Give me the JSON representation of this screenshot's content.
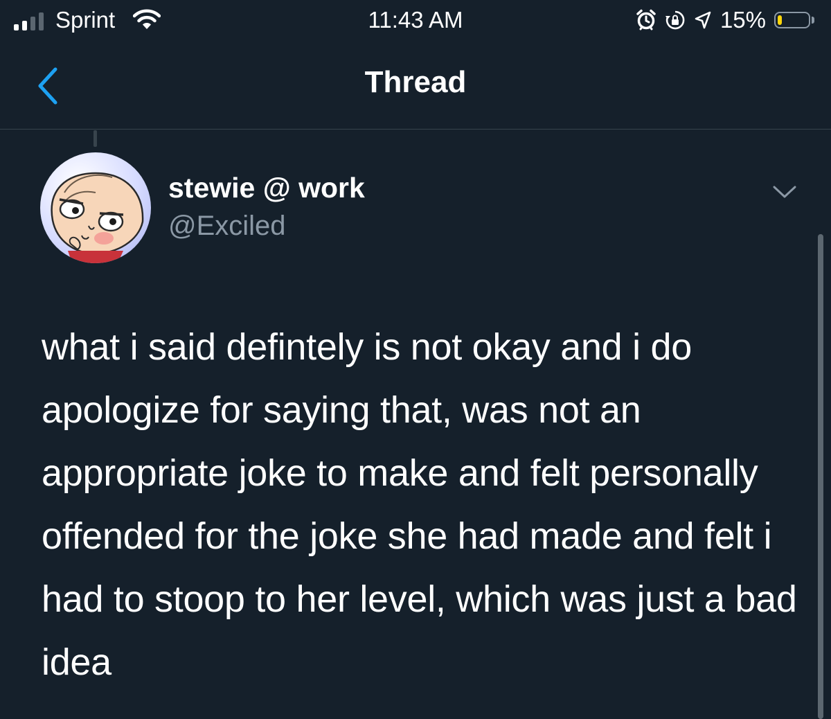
{
  "status_bar": {
    "carrier": "Sprint",
    "time": "11:43 AM",
    "battery": "15%",
    "battery_level": 0.15,
    "icons": [
      "signal-icon",
      "wifi-icon",
      "alarm-icon",
      "rotation-lock-icon",
      "location-icon",
      "battery-icon"
    ]
  },
  "header": {
    "title": "Thread",
    "back_icon": "chevron-left-icon"
  },
  "tweet": {
    "display_name": "stewie @ work",
    "handle": "@Exciled",
    "text": "what i said defintely is not okay and i do apologize for saying that, was not an appropriate joke to make and felt personally offended for the joke she had made and felt i had to stoop to her level, which was just a bad idea",
    "more_icon": "chevron-down-icon"
  },
  "colors": {
    "background": "#15202b",
    "text": "#ffffff",
    "secondary": "#8b98a5",
    "accent": "#1da1f2",
    "battery_low": "#ffd60a",
    "divider": "#38444d"
  }
}
